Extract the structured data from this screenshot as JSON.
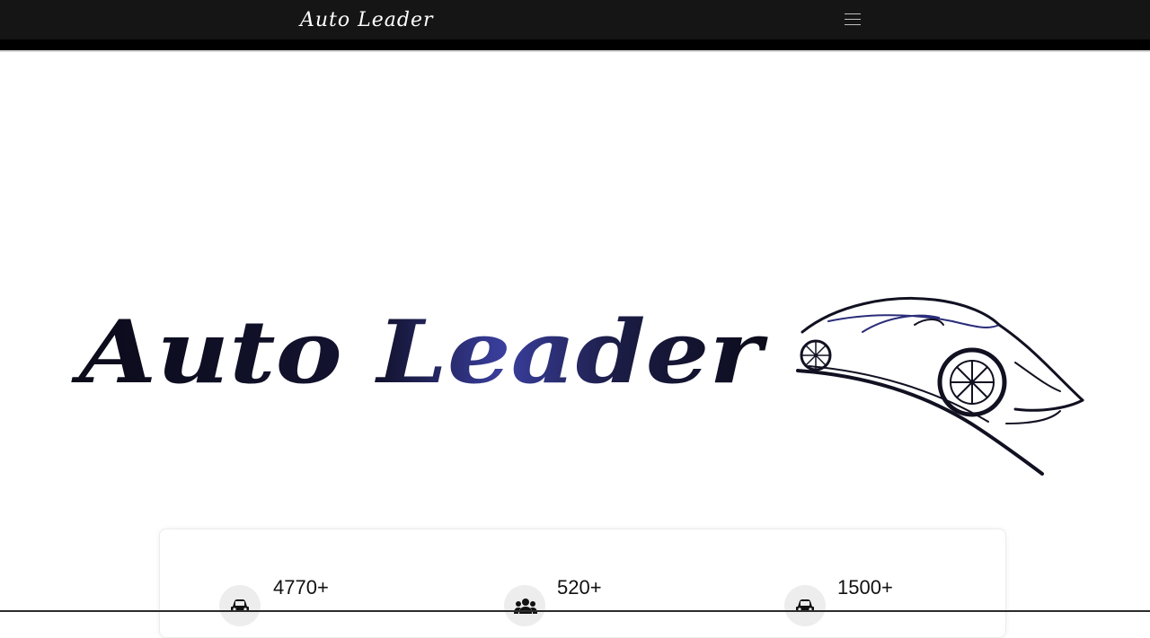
{
  "navbar": {
    "brand": "Auto Leader",
    "menu_icon": "hamburger-menu-icon"
  },
  "hero": {
    "logo_text": "Auto Leader",
    "logo_icon": "sports-car-logo",
    "colors": {
      "logo_dark": "#0b0b1a",
      "logo_accent": "#3a3f9e"
    }
  },
  "stats": [
    {
      "value": "4770+",
      "icon": "car-icon"
    },
    {
      "value": "520+",
      "icon": "users-icon"
    },
    {
      "value": "1500+",
      "icon": "car-icon"
    }
  ],
  "colors": {
    "navbar_bg": "#151515",
    "page_bg": "#ffffff"
  }
}
